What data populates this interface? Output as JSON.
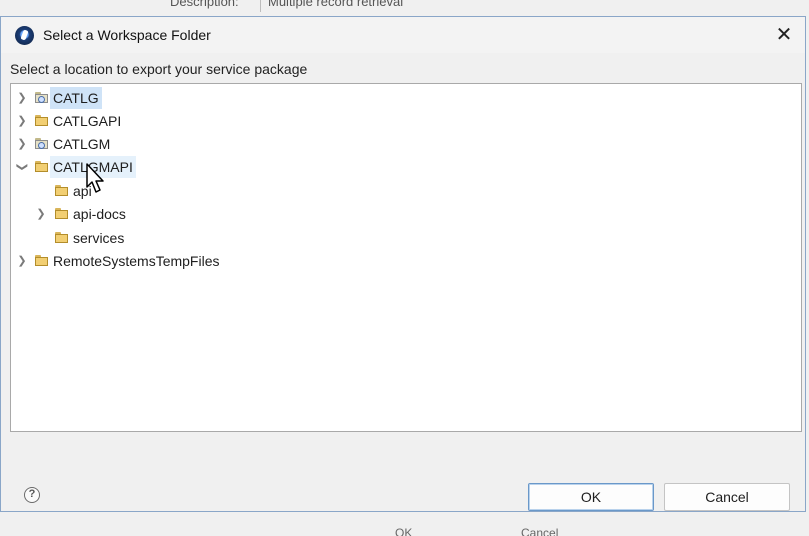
{
  "background": {
    "desc_label": "Description:",
    "desc_value": "Multiple record retrieval",
    "ok_label": "OK",
    "cancel_label": "Cancel"
  },
  "dialog": {
    "title": "Select a Workspace Folder",
    "close_icon": "close-icon",
    "app_icon": "app-icon",
    "instruction": "Select a location to export your service package"
  },
  "tree": {
    "items": [
      {
        "label": "CATLG",
        "icon": "project-folder-icon",
        "expander": "collapsed",
        "selected": true
      },
      {
        "label": "CATLGAPI",
        "icon": "folder-icon",
        "expander": "collapsed"
      },
      {
        "label": "CATLGM",
        "icon": "project-folder-icon",
        "expander": "collapsed"
      },
      {
        "label": "CATLGMAPI",
        "icon": "folder-icon",
        "expander": "expanded",
        "hover": true
      },
      {
        "label": "api",
        "icon": "folder-icon",
        "expander": "none",
        "level": 1
      },
      {
        "label": "api-docs",
        "icon": "folder-icon",
        "expander": "collapsed",
        "level": 1
      },
      {
        "label": "services",
        "icon": "folder-icon",
        "expander": "none",
        "level": 1
      },
      {
        "label": "RemoteSystemsTempFiles",
        "icon": "folder-icon",
        "expander": "collapsed"
      }
    ]
  },
  "buttons": {
    "help_icon": "help-icon",
    "ok": "OK",
    "cancel": "Cancel"
  },
  "colors": {
    "selection": "#cfe3f7",
    "dialog_border": "#8aa6c8",
    "ok_border": "#6a98c9"
  }
}
